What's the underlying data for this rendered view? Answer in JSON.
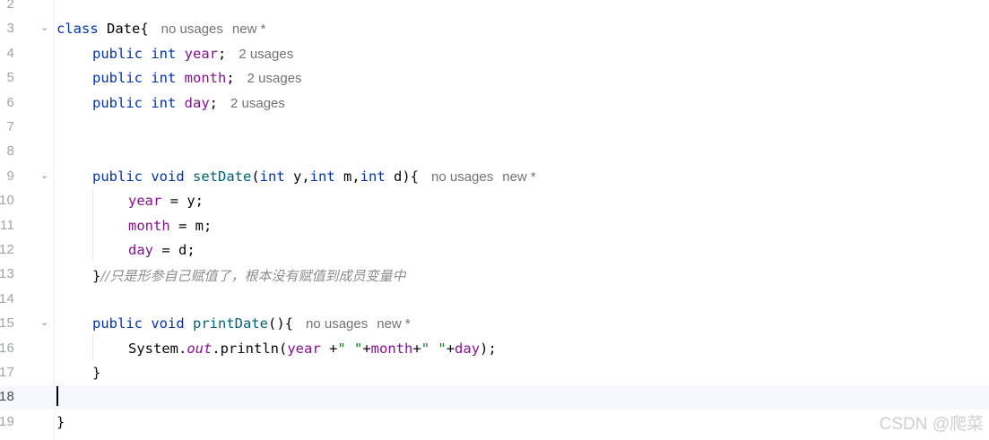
{
  "editor": {
    "lines": [
      {
        "num": "2"
      },
      {
        "num": "3",
        "tokens": [
          {
            "t": "kw",
            "v": "class "
          },
          {
            "t": "cls",
            "v": "Date"
          },
          {
            "t": "plain",
            "v": "{"
          }
        ],
        "hints": [
          "no usages",
          "new *"
        ]
      },
      {
        "num": "4",
        "tokens": [
          {
            "t": "kw",
            "v": "public "
          },
          {
            "t": "kw",
            "v": "int "
          },
          {
            "t": "field",
            "v": "year"
          },
          {
            "t": "plain",
            "v": ";"
          }
        ],
        "hints": [
          "2 usages"
        ]
      },
      {
        "num": "5",
        "tokens": [
          {
            "t": "kw",
            "v": "public "
          },
          {
            "t": "kw",
            "v": "int "
          },
          {
            "t": "field",
            "v": "month"
          },
          {
            "t": "plain",
            "v": ";"
          }
        ],
        "hints": [
          "2 usages"
        ]
      },
      {
        "num": "6",
        "tokens": [
          {
            "t": "kw",
            "v": "public "
          },
          {
            "t": "kw",
            "v": "int "
          },
          {
            "t": "field",
            "v": "day"
          },
          {
            "t": "plain",
            "v": ";"
          }
        ],
        "hints": [
          "2 usages"
        ]
      },
      {
        "num": "7"
      },
      {
        "num": "8"
      },
      {
        "num": "9",
        "tokens": [
          {
            "t": "kw",
            "v": "public "
          },
          {
            "t": "kw",
            "v": "void "
          },
          {
            "t": "fn",
            "v": "setDate"
          },
          {
            "t": "plain",
            "v": "("
          },
          {
            "t": "kw",
            "v": "int "
          },
          {
            "t": "plain",
            "v": "y,"
          },
          {
            "t": "kw",
            "v": "int "
          },
          {
            "t": "plain",
            "v": "m,"
          },
          {
            "t": "kw",
            "v": "int "
          },
          {
            "t": "plain",
            "v": "d){"
          }
        ],
        "hints": [
          "no usages",
          "new *"
        ]
      },
      {
        "num": "10",
        "tokens": [
          {
            "t": "field",
            "v": "year"
          },
          {
            "t": "plain",
            "v": " = y;"
          }
        ]
      },
      {
        "num": "11",
        "tokens": [
          {
            "t": "field",
            "v": "month"
          },
          {
            "t": "plain",
            "v": " = m;"
          }
        ]
      },
      {
        "num": "12",
        "tokens": [
          {
            "t": "field",
            "v": "day"
          },
          {
            "t": "plain",
            "v": " = d;"
          }
        ]
      },
      {
        "num": "13",
        "tokens": [
          {
            "t": "plain",
            "v": "}"
          },
          {
            "t": "cmt",
            "v": "//只是形参自己赋值了，根本没有赋值到成员变量中"
          }
        ]
      },
      {
        "num": "14"
      },
      {
        "num": "15",
        "tokens": [
          {
            "t": "kw",
            "v": "public "
          },
          {
            "t": "kw",
            "v": "void "
          },
          {
            "t": "fn",
            "v": "printDate"
          },
          {
            "t": "plain",
            "v": "(){"
          }
        ],
        "hints": [
          "no usages",
          "new *"
        ]
      },
      {
        "num": "16",
        "tokens": [
          {
            "t": "plain",
            "v": "System."
          },
          {
            "t": "static-field",
            "v": "out"
          },
          {
            "t": "plain",
            "v": ".println("
          },
          {
            "t": "field",
            "v": "year"
          },
          {
            "t": "plain",
            "v": " +"
          },
          {
            "t": "str",
            "v": "\" \""
          },
          {
            "t": "plain",
            "v": "+"
          },
          {
            "t": "field",
            "v": "month"
          },
          {
            "t": "plain",
            "v": "+"
          },
          {
            "t": "str",
            "v": "\" \""
          },
          {
            "t": "plain",
            "v": "+"
          },
          {
            "t": "field",
            "v": "day"
          },
          {
            "t": "plain",
            "v": ");"
          }
        ]
      },
      {
        "num": "17",
        "tokens": [
          {
            "t": "plain",
            "v": "}"
          }
        ]
      },
      {
        "num": "18"
      },
      {
        "num": "19",
        "tokens": [
          {
            "t": "plain",
            "v": "}"
          }
        ]
      }
    ],
    "fold_marker": "⌄"
  },
  "watermark": "CSDN @爬菜"
}
